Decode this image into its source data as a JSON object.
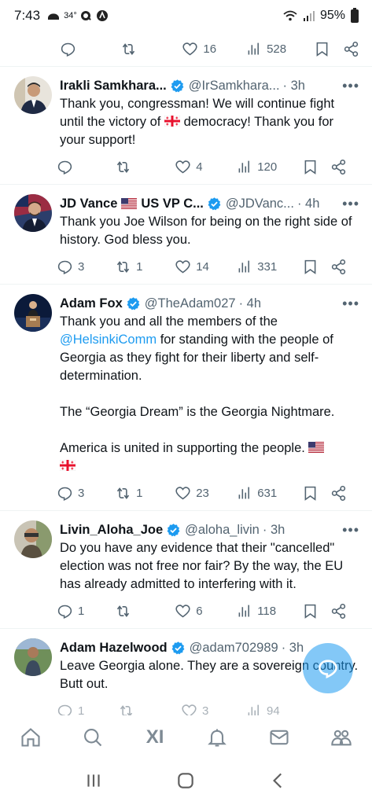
{
  "status_bar": {
    "time": "7:43",
    "temp": "34°",
    "battery": "95%"
  },
  "top_actions": {
    "reply": "",
    "retweet": "",
    "likes": "16",
    "views": "528"
  },
  "tweets": [
    {
      "name": "Irakli Samkhara...",
      "handle": "@IrSamkhara...",
      "time": "· 3h",
      "text_parts": [
        "Thank you, congressman! We will continue fight until the victory of ",
        " democracy! Thank you for your support!"
      ],
      "replies": "",
      "retweets": "",
      "likes": "4",
      "views": "120"
    },
    {
      "name": "JD Vance",
      "name_suffix": "US VP C...",
      "handle": "@JDVanc...",
      "time": "· 4h",
      "text": "Thank you Joe Wilson for being on the right side of history. God bless you.",
      "replies": "3",
      "retweets": "1",
      "likes": "14",
      "views": "331"
    },
    {
      "name": "Adam Fox",
      "handle": "@TheAdam027",
      "time": "· 4h",
      "text_before": "Thank you and all the members of the ",
      "mention": "@HelsinkiComm",
      "text_after": " for standing with the people of Georgia as they fight for their liberty and self-determination.",
      "text_p2": "The “Georgia Dream” is the Georgia Nightmare.",
      "text_p3": "America is united in supporting the people. ",
      "replies": "3",
      "retweets": "1",
      "likes": "23",
      "views": "631"
    },
    {
      "name": "Livin_Aloha_Joe",
      "handle": "@aloha_livin",
      "time": "· 3h",
      "text": "Do you have any evidence that their \"cancelled\" election was not free nor fair? By the way, the EU has already admitted to interfering with it.",
      "replies": "1",
      "retweets": "",
      "likes": "6",
      "views": "118"
    },
    {
      "name": "Adam Hazelwood",
      "handle": "@adam702989",
      "time": "· 3h",
      "text": "Leave Georgia alone. They are a sovereign country. Butt out.",
      "replies": "1",
      "retweets": "",
      "likes": "3",
      "views": "94"
    }
  ],
  "bottom_nav": {
    "grok_label": "XI"
  },
  "colors": {
    "accent": "#1d9bf0",
    "secondary_text": "#536471",
    "divider": "#eff3f4"
  }
}
